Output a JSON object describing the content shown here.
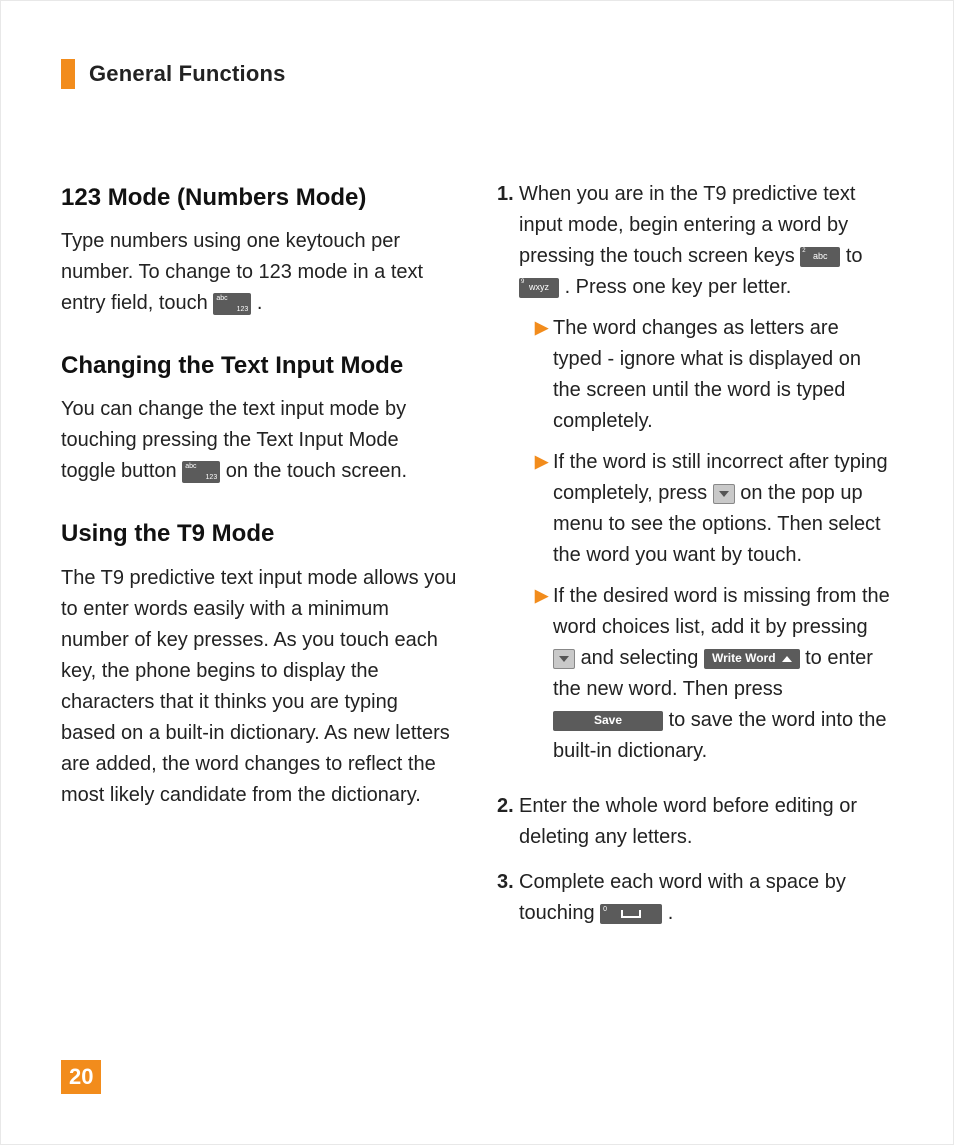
{
  "header": {
    "title": "General Functions"
  },
  "page_number": "20",
  "left": {
    "h1": "123 Mode (Numbers Mode)",
    "p1a": "Type numbers using one keytouch per number. To change to 123 mode in a text entry field, touch ",
    "p1b": ".",
    "h2": "Changing the Text Input Mode",
    "p2a": "You can change the text input mode by touching pressing the Text Input Mode toggle button ",
    "p2b": " on the touch screen.",
    "h3": "Using the T9 Mode",
    "p3": "The T9 predictive text input mode allows you to enter words easily with a minimum number of key presses. As you touch each key, the phone begins to display the characters that it thinks you are typing based on a built-in dictionary. As new letters are added, the word changes to reflect the most likely candidate from the dictionary."
  },
  "right": {
    "item1": {
      "num": "1.",
      "t1": "When you are in the T9 predictive text input mode, begin entering a word by pressing the touch screen keys ",
      "t_to": " to ",
      "t2": ". Press one key per letter.",
      "bullet_a": "The word changes as letters are typed - ignore what is displayed on the screen until the word is typed completely.",
      "bullet_b1": "If the word is still incorrect after typing completely, press ",
      "bullet_b2": " on the pop up menu to see the options. Then select the word you want by touch.",
      "bullet_c1": "If the desired word is missing from the word choices list, add it by pressing ",
      "bullet_c2": " and selecting ",
      "bullet_c3": " to enter the new word. Then press ",
      "bullet_c4": " to save the word into the built-in dictionary."
    },
    "item2": {
      "num": "2.",
      "t": "Enter the whole word before editing or deleting any letters."
    },
    "item3": {
      "num": "3.",
      "t1": "Complete each word with a space by touching ",
      "t2": "."
    }
  },
  "icons": {
    "abc123_top": "abc",
    "abc123_bottom": "123",
    "abc_key_sup": "2",
    "abc_key": "abc",
    "wxyz_key_sup": "9",
    "wxyz_key": "wxyz",
    "write_word": "Write Word",
    "save": "Save",
    "space_sup": "0"
  }
}
